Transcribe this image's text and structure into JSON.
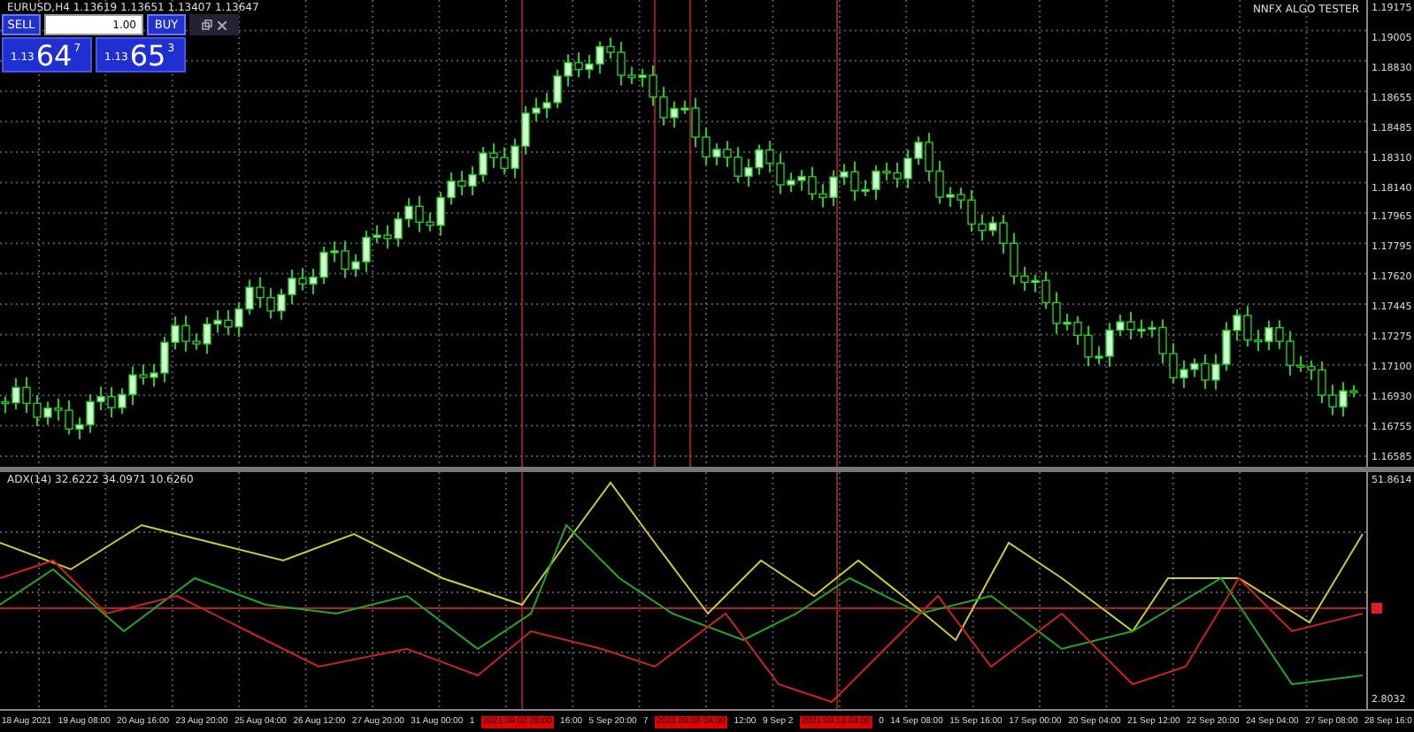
{
  "chart": {
    "title": "EURUSD,H4  1.13619 1.13651 1.13407 1.13647",
    "watermark": "NNFX ALGO TESTER",
    "price_ticks": [
      "1.19175",
      "1.19005",
      "1.18830",
      "1.18655",
      "1.18485",
      "1.18310",
      "1.18140",
      "1.17965",
      "1.17795",
      "1.17620",
      "1.17445",
      "1.17275",
      "1.17100",
      "1.16930",
      "1.16755",
      "1.16585"
    ]
  },
  "trade_panel": {
    "sell_label": "SELL",
    "buy_label": "BUY",
    "volume": "1.00",
    "sell_price": {
      "prefix": "1.13",
      "big": "64",
      "small": "7"
    },
    "buy_price": {
      "prefix": "1.13",
      "big": "65",
      "small": "3"
    }
  },
  "indicator": {
    "label": "ADX(14) 32.6222 34.0971 10.6260",
    "top_tick": "51.8614",
    "bottom_tick": "2.8032"
  },
  "time_axis": [
    {
      "text": "18 Aug 2021",
      "kind": "tick"
    },
    {
      "text": "19 Aug 08:00",
      "kind": "tick"
    },
    {
      "text": "20 Aug 16:00",
      "kind": "tick"
    },
    {
      "text": "23 Aug 20:00",
      "kind": "tick"
    },
    {
      "text": "25 Aug 04:00",
      "kind": "tick"
    },
    {
      "text": "26 Aug 12:00",
      "kind": "tick"
    },
    {
      "text": "27 Aug 20:00",
      "kind": "tick"
    },
    {
      "text": "31 Aug 00:00",
      "kind": "tick"
    },
    {
      "text": "1",
      "kind": "tick"
    },
    {
      "text": "2021.09.02 08:00",
      "kind": "marker"
    },
    {
      "text": "16:00",
      "kind": "tick"
    },
    {
      "text": "5 Sep 20:00",
      "kind": "tick"
    },
    {
      "text": "7",
      "kind": "tick"
    },
    {
      "text": "2021.09.08 04:00",
      "kind": "marker"
    },
    {
      "text": "12:00",
      "kind": "tick"
    },
    {
      "text": "9 Sep 2",
      "kind": "tick"
    },
    {
      "text": "2021.09.13 04:00",
      "kind": "marker"
    },
    {
      "text": "0",
      "kind": "tick"
    },
    {
      "text": "14 Sep 08:00",
      "kind": "tick"
    },
    {
      "text": "15 Sep 16:00",
      "kind": "tick"
    },
    {
      "text": "17 Sep 00:00",
      "kind": "tick"
    },
    {
      "text": "20 Sep 04:00",
      "kind": "tick"
    },
    {
      "text": "21 Sep 12:00",
      "kind": "tick"
    },
    {
      "text": "22 Sep 20:00",
      "kind": "tick"
    },
    {
      "text": "24 Sep 04:00",
      "kind": "tick"
    },
    {
      "text": "27 Sep 08:00",
      "kind": "tick"
    },
    {
      "text": "28 Sep 16:0",
      "kind": "tick"
    }
  ]
}
